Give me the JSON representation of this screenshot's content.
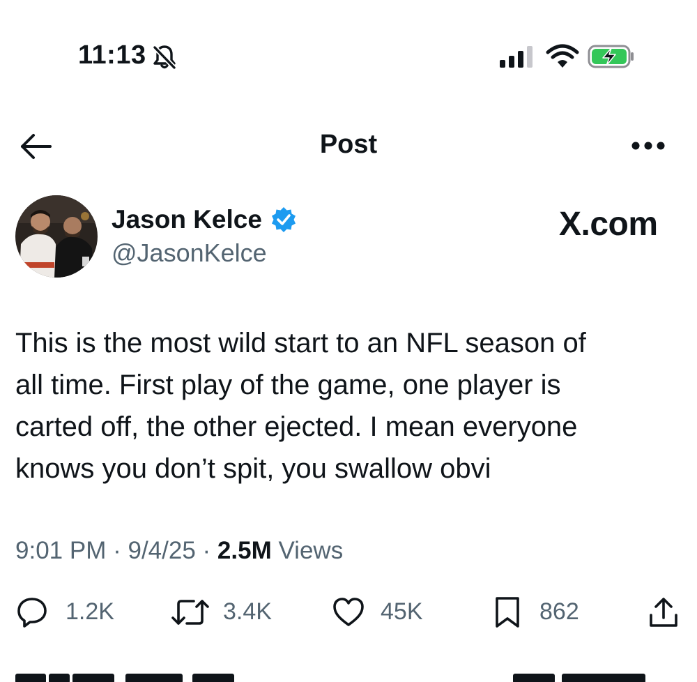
{
  "status_bar": {
    "time": "11:13",
    "icons": [
      "bell-slash-icon",
      "cellular-signal-icon",
      "wifi-icon",
      "battery-charging-icon"
    ],
    "battery_color": "#34c759"
  },
  "nav": {
    "title": "Post",
    "back_icon": "arrow-left-icon",
    "more_icon": "more-horizontal-icon"
  },
  "post": {
    "author_name": "Jason Kelce",
    "handle": "@JasonKelce",
    "verified_color": "#1d9bf0",
    "brand": "X.com",
    "text": "This is the most wild start to an NFL season of\nall time.  First play of the game, one player is\ncarted off, the other ejected.  I mean everyone\nknows you don’t spit, you swallow obvi",
    "time": "9:01 PM",
    "date": "9/4/25",
    "views_count": "2.5M",
    "views_label": "Views"
  },
  "actions": {
    "replies": "1.2K",
    "reposts": "3.4K",
    "likes": "45K",
    "bookmarks": "862"
  }
}
